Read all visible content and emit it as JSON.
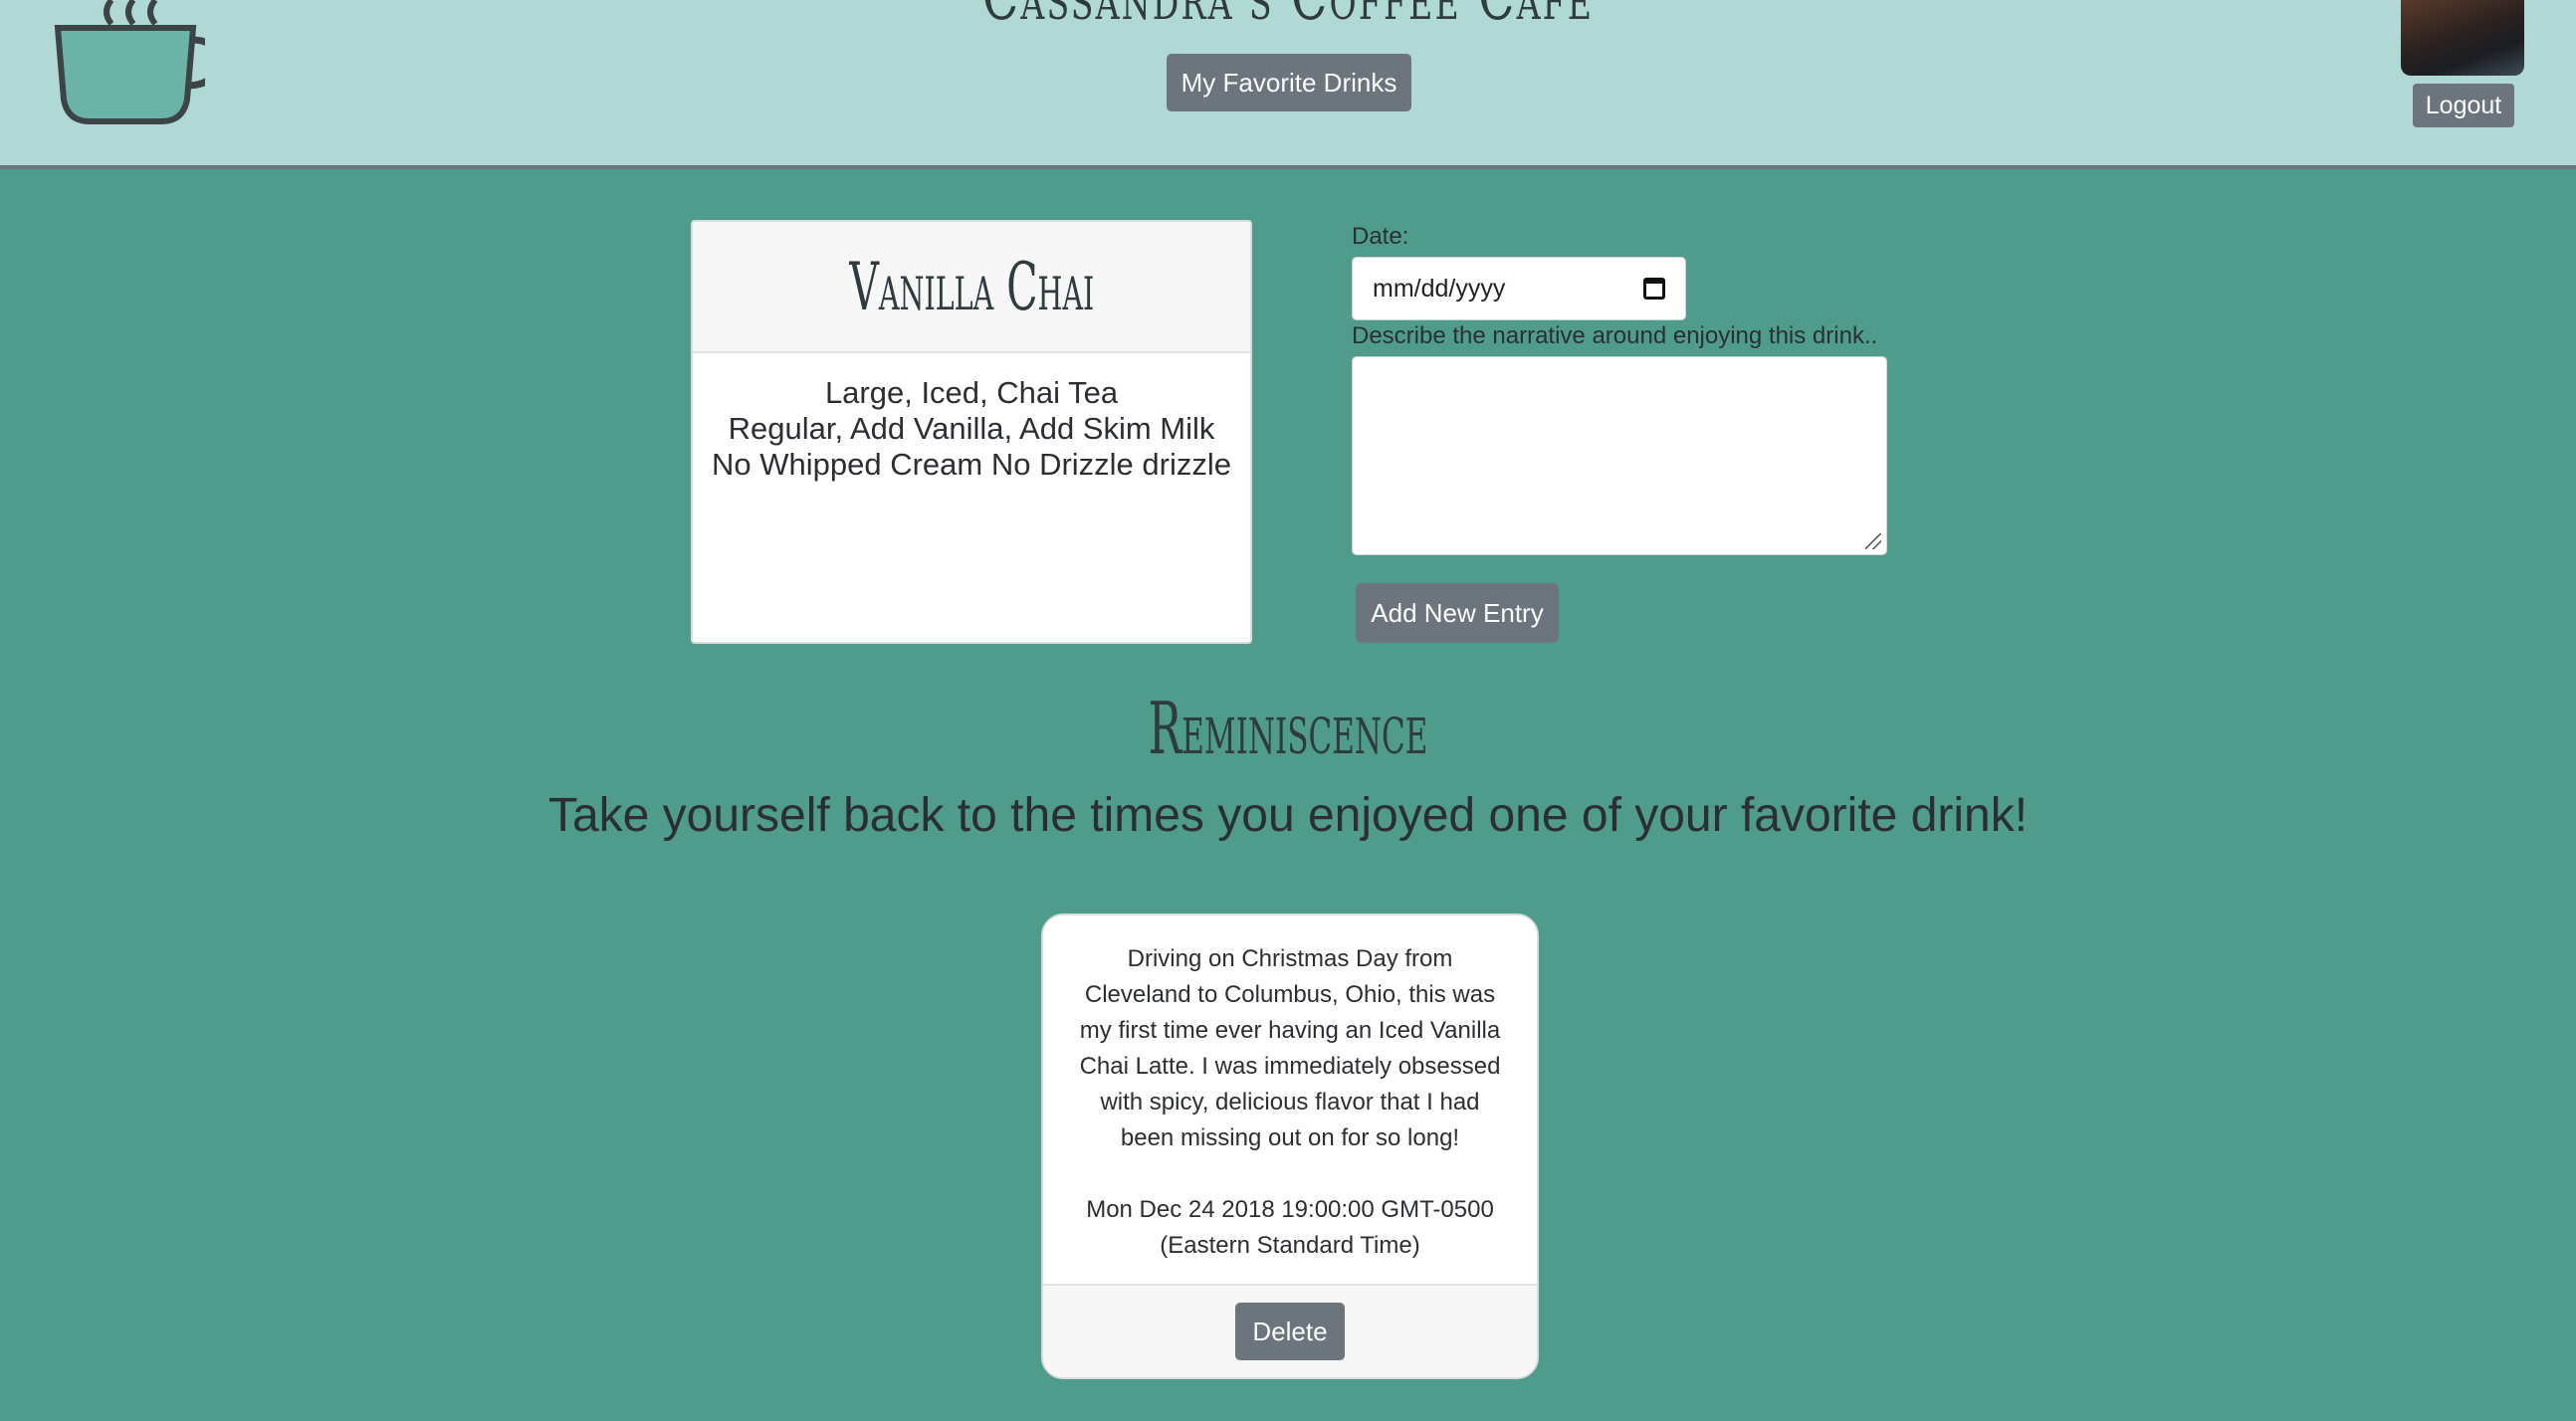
{
  "header": {
    "site_title": "Cassandra's Coffee Cafe",
    "favorites_button": "My Favorite Drinks",
    "logout_button": "Logout"
  },
  "drink": {
    "name": "Vanilla Chai",
    "details": [
      "Large, Iced, Chai Tea",
      "Regular, Add Vanilla, Add Skim Milk",
      "No Whipped Cream No Drizzle drizzle"
    ]
  },
  "form": {
    "date_label": "Date:",
    "date_value": "mm/dd/yyyy",
    "narrative_label": "Describe the narrative around enjoying this drink..",
    "narrative_value": "",
    "submit_button": "Add New Entry"
  },
  "section": {
    "title": "Reminiscence",
    "subtitle": "Take yourself back to the times you enjoyed one of your favorite drink!"
  },
  "entries": [
    {
      "text": "Driving on Christmas Day from Cleveland to Columbus, Ohio, this was my first time ever having an Iced Vanilla Chai Latte. I was immediately obsessed with spicy, delicious flavor that I had been missing out on for so long!",
      "date": "Mon Dec 24 2018 19:00:00 GMT-0500 (Eastern Standard Time)",
      "delete_button": "Delete"
    }
  ],
  "colors": {
    "page_background": "#4f9c8d",
    "header_background": "#b0d8d4",
    "button": "#6c757d"
  },
  "icons": [
    "coffee-cup-logo",
    "calendar-icon",
    "resize-handle-icon"
  ]
}
